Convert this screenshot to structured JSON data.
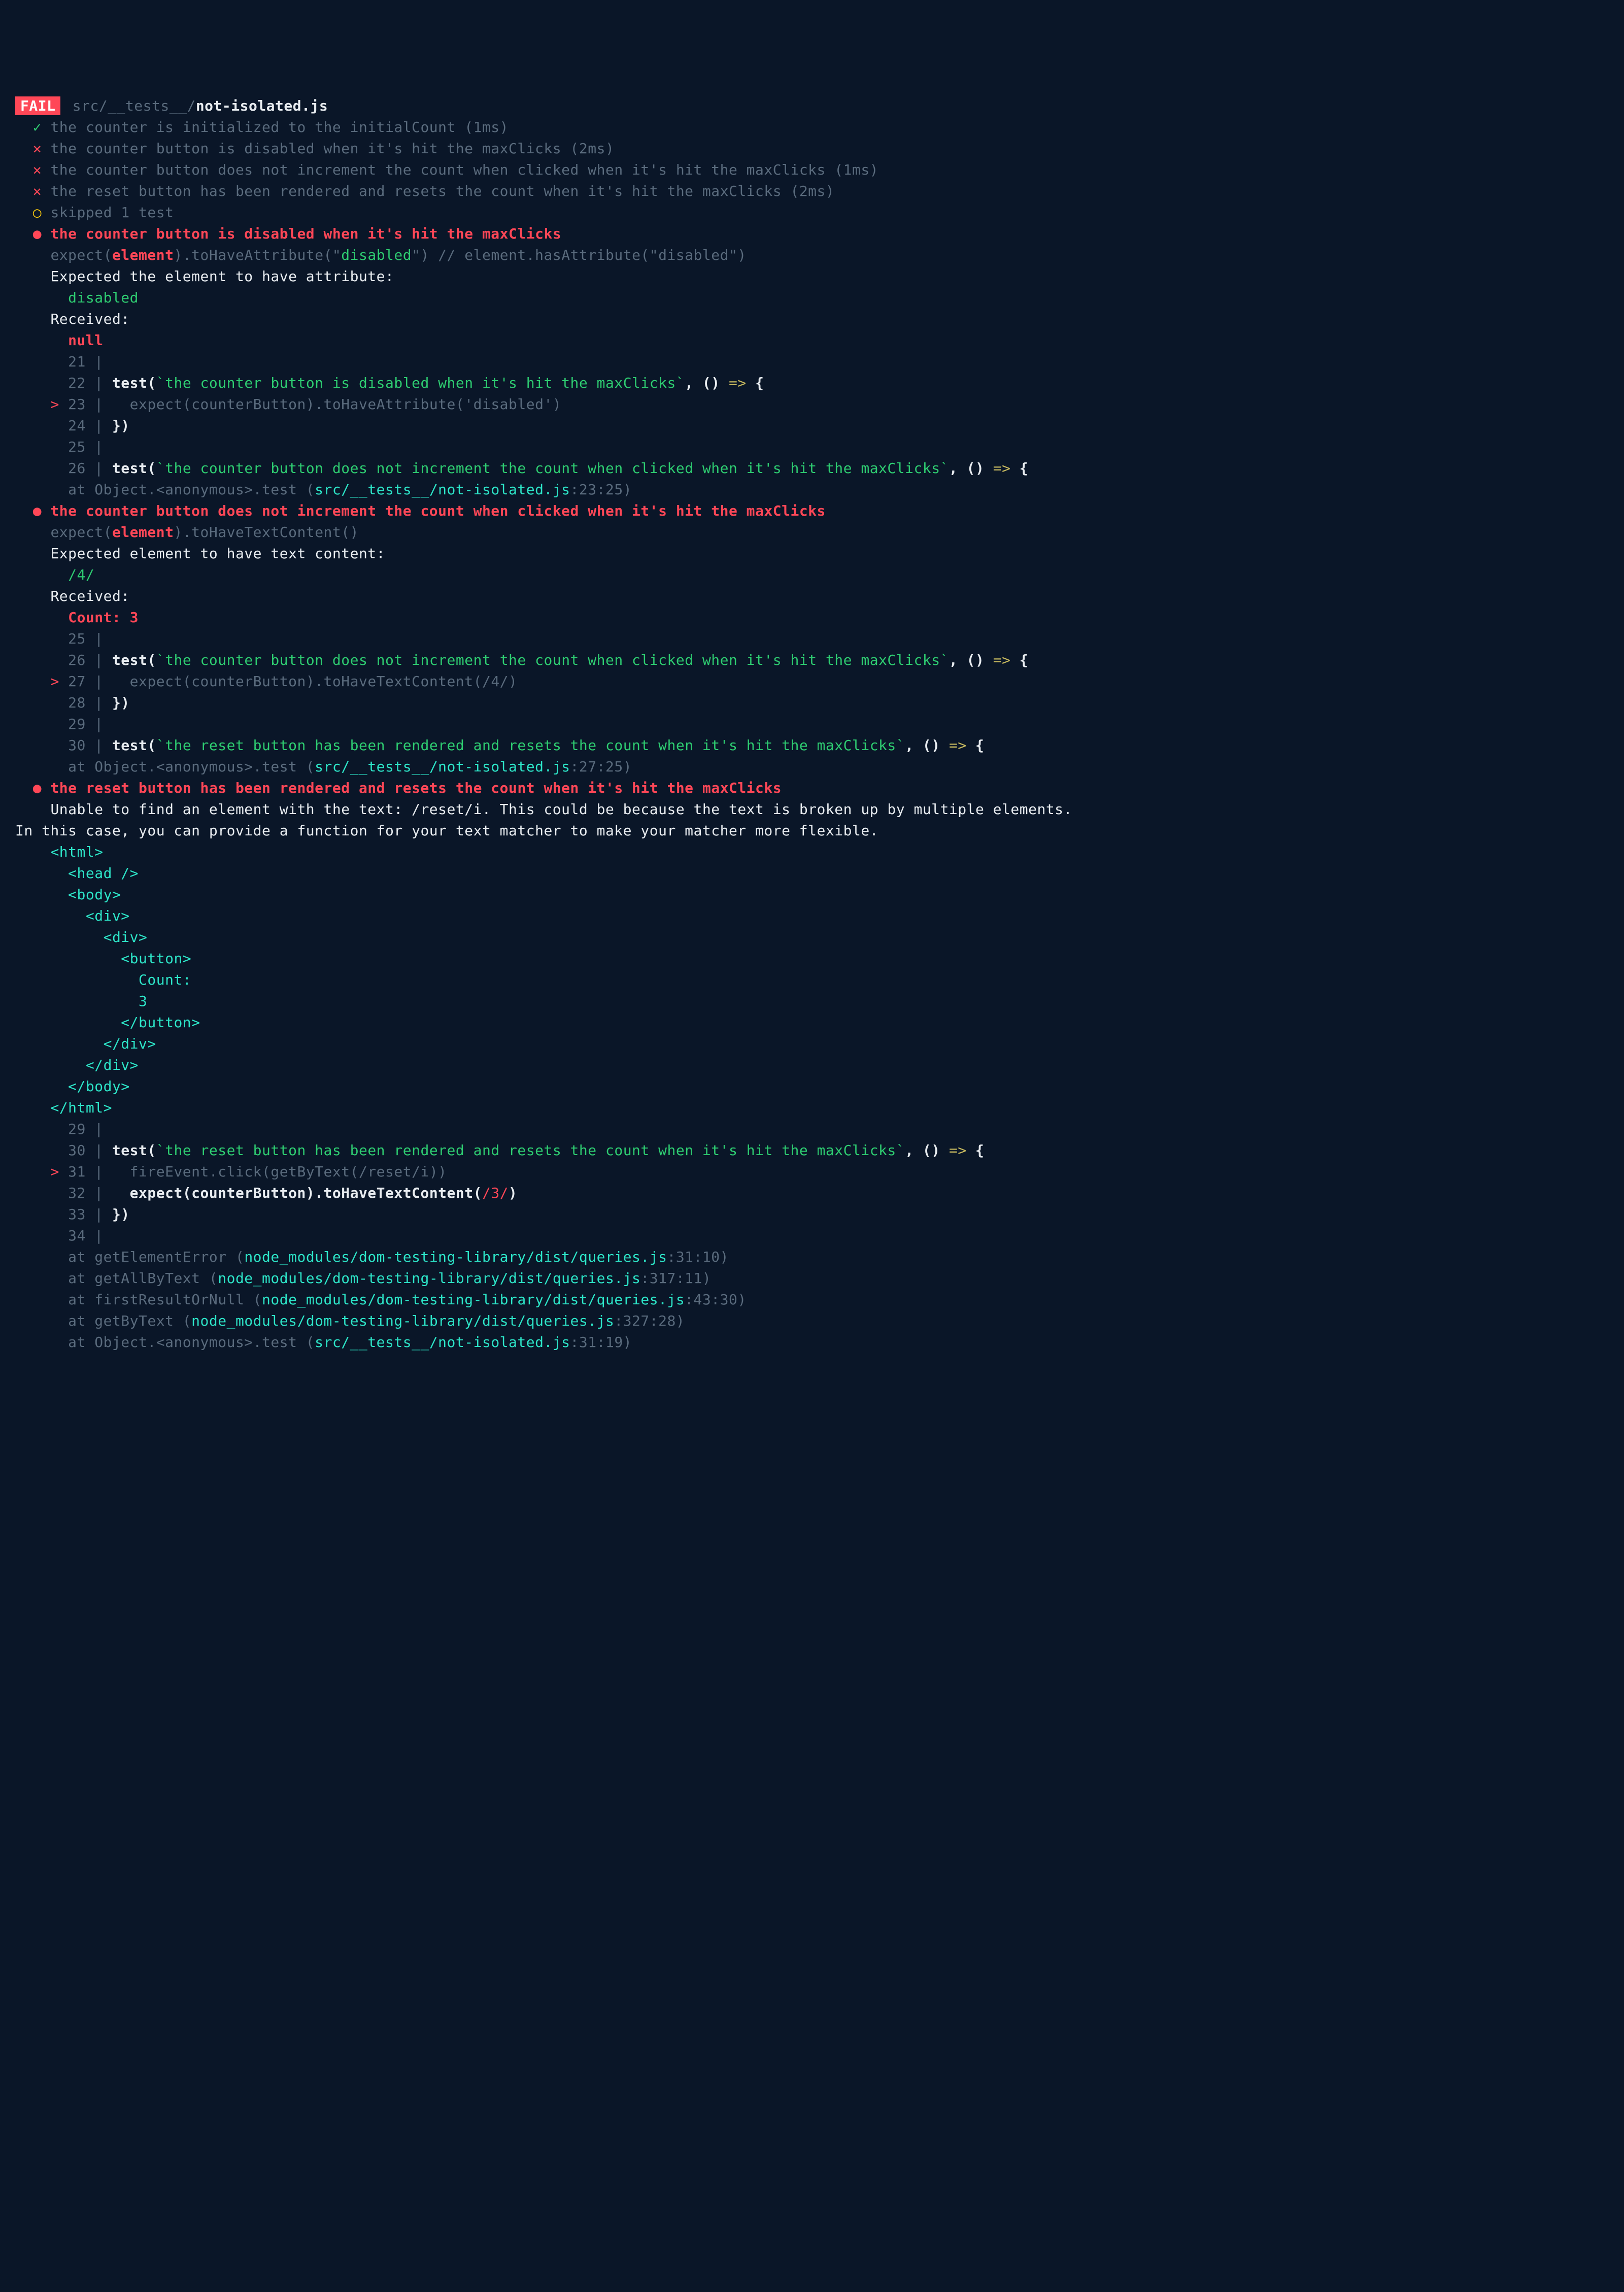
{
  "header": {
    "fail_label": "FAIL",
    "file_dim": "src/__tests__/",
    "file_bold": "not-isolated.js"
  },
  "summary": [
    {
      "marker": "✓",
      "cls": "pass",
      "text": "the counter is initialized to the initialCount (1ms)"
    },
    {
      "marker": "✕",
      "cls": "fail",
      "text": "the counter button is disabled when it's hit the maxClicks (2ms)"
    },
    {
      "marker": "✕",
      "cls": "fail",
      "text": "the counter button does not increment the count when clicked when it's hit the maxClicks (1ms)"
    },
    {
      "marker": "✕",
      "cls": "fail",
      "text": "the reset button has been rendered and resets the count when it's hit the maxClicks (2ms)"
    },
    {
      "marker": "○",
      "cls": "skip",
      "text": "skipped 1 test"
    }
  ],
  "errors": [
    {
      "bullet": "●",
      "title": "the counter button is disabled when it's hit the maxClicks",
      "assert": {
        "pre": "expect(",
        "el": "element",
        "mid": ").toHaveAttribute(\"",
        "arg": "disabled",
        "post": "\") ",
        "comment": "// element.hasAttribute(\"disabled\")"
      },
      "exp_label": "Expected the element to have attribute:",
      "exp_value": "disabled",
      "rec_label": "Received:",
      "rec_value": "null",
      "snippet": [
        {
          "caret": " ",
          "num": "21",
          "pipe": "|",
          "plain": "",
          "tokens": []
        },
        {
          "caret": " ",
          "num": "22",
          "pipe": "|",
          "plain": " ",
          "tokens": [
            {
              "t": "test(",
              "c": "white bold"
            },
            {
              "t": "`the counter button is disabled when it's hit the maxClicks`",
              "c": "green"
            },
            {
              "t": ", () ",
              "c": "white bold"
            },
            {
              "t": "=>",
              "c": "yellow"
            },
            {
              "t": " {",
              "c": "white bold"
            }
          ]
        },
        {
          "caret": ">",
          "num": "23",
          "pipe": "|",
          "plain": "   expect(counterButton).toHaveAttribute('disabled')",
          "tokens": []
        },
        {
          "caret": " ",
          "num": "24",
          "pipe": "|",
          "plain": " ",
          "tokens": [
            {
              "t": "})",
              "c": "white bold"
            }
          ]
        },
        {
          "caret": " ",
          "num": "25",
          "pipe": "|",
          "plain": "",
          "tokens": []
        },
        {
          "caret": " ",
          "num": "26",
          "pipe": "|",
          "plain": " ",
          "tokens": [
            {
              "t": "test(",
              "c": "white bold"
            },
            {
              "t": "`the counter button does not increment the count when clicked when it's hit the maxClicks`",
              "c": "green"
            },
            {
              "t": ", () ",
              "c": "white bold"
            },
            {
              "t": "=>",
              "c": "yellow"
            },
            {
              "t": " {",
              "c": "white bold"
            }
          ]
        }
      ],
      "stack": [
        {
          "pre": "at Object.<anonymous>.test (",
          "loc": "src/__tests__/not-isolated.js",
          "suffix": ":23:25)"
        }
      ]
    },
    {
      "bullet": "●",
      "title": "the counter button does not increment the count when clicked when it's hit the maxClicks",
      "assert": {
        "pre": "expect(",
        "el": "element",
        "mid": ").toHaveTextContent()",
        "arg": "",
        "post": "",
        "comment": ""
      },
      "exp_label": "Expected element to have text content:",
      "exp_value": "/4/",
      "rec_label": "Received:",
      "rec_value": "Count: 3",
      "snippet": [
        {
          "caret": " ",
          "num": "25",
          "pipe": "|",
          "plain": "",
          "tokens": []
        },
        {
          "caret": " ",
          "num": "26",
          "pipe": "|",
          "plain": " ",
          "tokens": [
            {
              "t": "test(",
              "c": "white bold"
            },
            {
              "t": "`the counter button does not increment the count when clicked when it's hit the maxClicks`",
              "c": "green"
            },
            {
              "t": ", () ",
              "c": "white bold"
            },
            {
              "t": "=>",
              "c": "yellow"
            },
            {
              "t": " {",
              "c": "white bold"
            }
          ]
        },
        {
          "caret": ">",
          "num": "27",
          "pipe": "|",
          "plain": "   expect(counterButton).toHaveTextContent(/4/)",
          "tokens": []
        },
        {
          "caret": " ",
          "num": "28",
          "pipe": "|",
          "plain": " ",
          "tokens": [
            {
              "t": "})",
              "c": "white bold"
            }
          ]
        },
        {
          "caret": " ",
          "num": "29",
          "pipe": "|",
          "plain": "",
          "tokens": []
        },
        {
          "caret": " ",
          "num": "30",
          "pipe": "|",
          "plain": " ",
          "tokens": [
            {
              "t": "test(",
              "c": "white bold"
            },
            {
              "t": "`the reset button has been rendered and resets the count when it's hit the maxClicks`",
              "c": "green"
            },
            {
              "t": ", () ",
              "c": "white bold"
            },
            {
              "t": "=>",
              "c": "yellow"
            },
            {
              "t": " {",
              "c": "white bold"
            }
          ]
        }
      ],
      "stack": [
        {
          "pre": "at Object.<anonymous>.test (",
          "loc": "src/__tests__/not-isolated.js",
          "suffix": ":27:25)"
        }
      ]
    },
    {
      "bullet": "●",
      "title": "the reset button has been rendered and resets the count when it's hit the maxClicks",
      "message": "Unable to find an element with the text: /reset/i. This could be because the text is broken up by multiple elements. In this case, you can provide a function for your text matcher to make your matcher more flexible.",
      "dom": [
        "<html>",
        "  <head />",
        "  <body>",
        "    <div>",
        "      <div>",
        "        <button>",
        "          Count: ",
        "          3",
        "        </button>",
        "      </div>",
        "    </div>",
        "  </body>",
        "</html>"
      ],
      "snippet": [
        {
          "caret": " ",
          "num": "29",
          "pipe": "|",
          "plain": "",
          "tokens": []
        },
        {
          "caret": " ",
          "num": "30",
          "pipe": "|",
          "plain": " ",
          "tokens": [
            {
              "t": "test(",
              "c": "white bold"
            },
            {
              "t": "`the reset button has been rendered and resets the count when it's hit the maxClicks`",
              "c": "green"
            },
            {
              "t": ", () ",
              "c": "white bold"
            },
            {
              "t": "=>",
              "c": "yellow"
            },
            {
              "t": " {",
              "c": "white bold"
            }
          ]
        },
        {
          "caret": ">",
          "num": "31",
          "pipe": "|",
          "plain": "   fireEvent.click(getByText(/reset/i))",
          "tokens": []
        },
        {
          "caret": " ",
          "num": "32",
          "pipe": "|",
          "plain": "   ",
          "tokens": [
            {
              "t": "expect(counterButton).toHaveTextContent(",
              "c": "white bold"
            },
            {
              "t": "/3/",
              "c": "red"
            },
            {
              "t": ")",
              "c": "white bold"
            }
          ]
        },
        {
          "caret": " ",
          "num": "33",
          "pipe": "|",
          "plain": " ",
          "tokens": [
            {
              "t": "})",
              "c": "white bold"
            }
          ]
        },
        {
          "caret": " ",
          "num": "34",
          "pipe": "|",
          "plain": "",
          "tokens": []
        }
      ],
      "stack": [
        {
          "pre": "at getElementError (",
          "loc": "node_modules/dom-testing-library/dist/queries.js",
          "suffix": ":31:10)"
        },
        {
          "pre": "at getAllByText (",
          "loc": "node_modules/dom-testing-library/dist/queries.js",
          "suffix": ":317:11)"
        },
        {
          "pre": "at firstResultOrNull (",
          "loc": "node_modules/dom-testing-library/dist/queries.js",
          "suffix": ":43:30)"
        },
        {
          "pre": "at getByText (",
          "loc": "node_modules/dom-testing-library/dist/queries.js",
          "suffix": ":327:28)"
        },
        {
          "pre": "at Object.<anonymous>.test (",
          "loc": "src/__tests__/not-isolated.js",
          "suffix": ":31:19)"
        }
      ]
    }
  ]
}
